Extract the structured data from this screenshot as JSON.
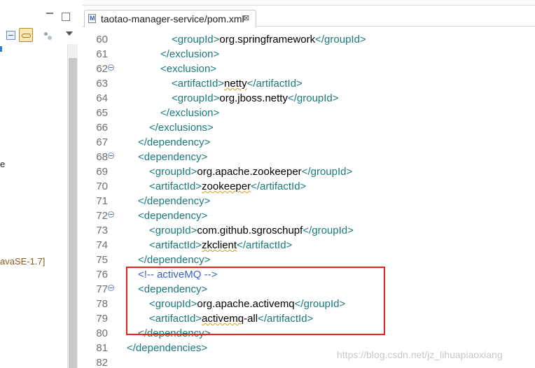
{
  "editor": {
    "tab": {
      "label": "taotao-manager-service/pom.xml",
      "close_icon": "⊠"
    },
    "lines": [
      {
        "num": "60",
        "fold": false,
        "indent": 4,
        "parts": [
          [
            "tag",
            "<groupId>"
          ],
          [
            "val",
            "org.springframework"
          ],
          [
            "tag",
            "</groupId>"
          ]
        ]
      },
      {
        "num": "61",
        "fold": false,
        "indent": 3,
        "parts": [
          [
            "tag",
            "</exclusion>"
          ]
        ]
      },
      {
        "num": "62",
        "fold": true,
        "indent": 3,
        "parts": [
          [
            "tag",
            "<exclusion>"
          ]
        ]
      },
      {
        "num": "63",
        "fold": false,
        "indent": 4,
        "parts": [
          [
            "tag",
            "<artifactId>"
          ],
          [
            "sq",
            "netty"
          ],
          [
            "tag",
            "</artifactId>"
          ]
        ]
      },
      {
        "num": "64",
        "fold": false,
        "indent": 4,
        "parts": [
          [
            "tag",
            "<groupId>"
          ],
          [
            "val",
            "org.jboss.netty"
          ],
          [
            "tag",
            "</groupId>"
          ]
        ]
      },
      {
        "num": "65",
        "fold": false,
        "indent": 3,
        "parts": [
          [
            "tag",
            "</exclusion>"
          ]
        ]
      },
      {
        "num": "66",
        "fold": false,
        "indent": 2,
        "parts": [
          [
            "tag",
            "</exclusions>"
          ]
        ]
      },
      {
        "num": "67",
        "fold": false,
        "indent": 1,
        "parts": [
          [
            "tag",
            "</dependency>"
          ]
        ]
      },
      {
        "num": "68",
        "fold": true,
        "indent": 1,
        "parts": [
          [
            "tag",
            "<dependency>"
          ]
        ]
      },
      {
        "num": "69",
        "fold": false,
        "indent": 2,
        "parts": [
          [
            "tag",
            "<groupId>"
          ],
          [
            "val",
            "org.apache.zookeeper"
          ],
          [
            "tag",
            "</groupId>"
          ]
        ]
      },
      {
        "num": "70",
        "fold": false,
        "indent": 2,
        "parts": [
          [
            "tag",
            "<artifactId>"
          ],
          [
            "sq",
            "zookeeper"
          ],
          [
            "tag",
            "</artifactId>"
          ]
        ]
      },
      {
        "num": "71",
        "fold": false,
        "indent": 1,
        "parts": [
          [
            "tag",
            "</dependency>"
          ]
        ]
      },
      {
        "num": "72",
        "fold": true,
        "indent": 1,
        "parts": [
          [
            "tag",
            "<dependency>"
          ]
        ]
      },
      {
        "num": "73",
        "fold": false,
        "indent": 2,
        "parts": [
          [
            "tag",
            "<groupId>"
          ],
          [
            "val",
            "com.github.sgroschupf"
          ],
          [
            "tag",
            "</groupId>"
          ]
        ]
      },
      {
        "num": "74",
        "fold": false,
        "indent": 2,
        "parts": [
          [
            "tag",
            "<artifactId>"
          ],
          [
            "sq",
            "zkclient"
          ],
          [
            "tag",
            "</artifactId>"
          ]
        ]
      },
      {
        "num": "75",
        "fold": false,
        "indent": 1,
        "parts": [
          [
            "tag",
            "</dependency>"
          ]
        ]
      },
      {
        "num": "76",
        "fold": false,
        "indent": 1,
        "parts": [
          [
            "cmt",
            "<!-- activeMQ -->"
          ]
        ]
      },
      {
        "num": "77",
        "fold": true,
        "indent": 1,
        "parts": [
          [
            "tag",
            "<dependency>"
          ]
        ]
      },
      {
        "num": "78",
        "fold": false,
        "indent": 2,
        "parts": [
          [
            "tag",
            "<groupId>"
          ],
          [
            "val",
            "org.apache.activemq"
          ],
          [
            "tag",
            "</groupId>"
          ]
        ]
      },
      {
        "num": "79",
        "fold": false,
        "indent": 2,
        "parts": [
          [
            "tag",
            "<artifactId>"
          ],
          [
            "sq",
            "activemq"
          ],
          [
            "val",
            "-all"
          ],
          [
            "tag",
            "</artifactId>"
          ]
        ]
      },
      {
        "num": "80",
        "fold": false,
        "indent": 1,
        "parts": [
          [
            "tag",
            "</dependency>"
          ]
        ]
      },
      {
        "num": "81",
        "fold": false,
        "indent": 0,
        "parts": [
          [
            "tag",
            "</dependencies>"
          ]
        ]
      },
      {
        "num": "82",
        "fold": false,
        "indent": 0,
        "parts": []
      }
    ]
  },
  "left_panel": {
    "tree_fragment_e": "e",
    "tree_fragment_jre": "avaSE-1.7]"
  },
  "watermark": "https://blog.csdn.net/jz_lihuapiaoxiang",
  "colors": {
    "tag": "#1a7a7a",
    "comment": "#3f5fbf",
    "highlight_box": "#e0251f"
  }
}
